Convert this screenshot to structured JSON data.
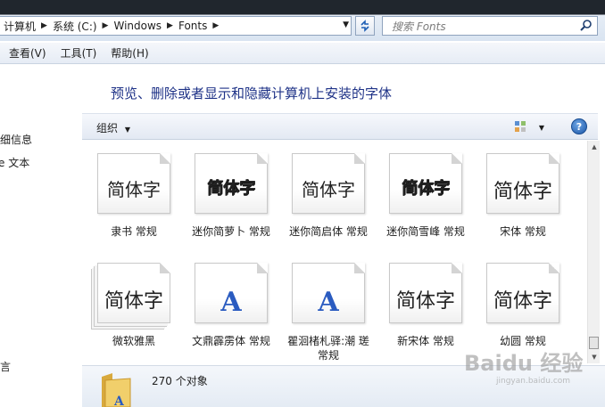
{
  "address": {
    "crumbs": [
      "计算机",
      "系统 (C:)",
      "Windows",
      "Fonts"
    ]
  },
  "search": {
    "placeholder": "搜索 Fonts"
  },
  "menu": {
    "view": "查看(V)",
    "tools": "工具(T)",
    "help": "帮助(H)"
  },
  "nav": {
    "item1": "详细信息",
    "item2": "e 文本",
    "item3": "语言"
  },
  "heading": "预览、删除或者显示和隐藏计算机上安装的字体",
  "toolbar": {
    "organize": "组织"
  },
  "fonts": [
    {
      "sample": "简体字",
      "name": "隶书 常规"
    },
    {
      "sample": "简体字",
      "name": "迷你简萝卜 常规"
    },
    {
      "sample": "简体字",
      "name": "迷你简启体 常规"
    },
    {
      "sample": "简体字",
      "name": "迷你简雪峰 常规"
    },
    {
      "sample": "简体字",
      "name": "宋体 常规"
    },
    {
      "sample": "简体字",
      "name": "微软雅黑"
    },
    {
      "sample": "A",
      "name": "文鼎霹雳体 常规"
    },
    {
      "sample": "A",
      "name": "瞿洄楮札驿:潮 瑳 常规"
    },
    {
      "sample": "简体字",
      "name": "新宋体 常规"
    },
    {
      "sample": "简体字",
      "name": "幼圆 常规"
    }
  ],
  "status": {
    "count": "270 个对象"
  },
  "watermark": {
    "brand": "Baidu 经验",
    "url": "jingyan.baidu.com"
  },
  "colors": {
    "heading": "#1e3287",
    "accent": "#2a5bc0"
  }
}
